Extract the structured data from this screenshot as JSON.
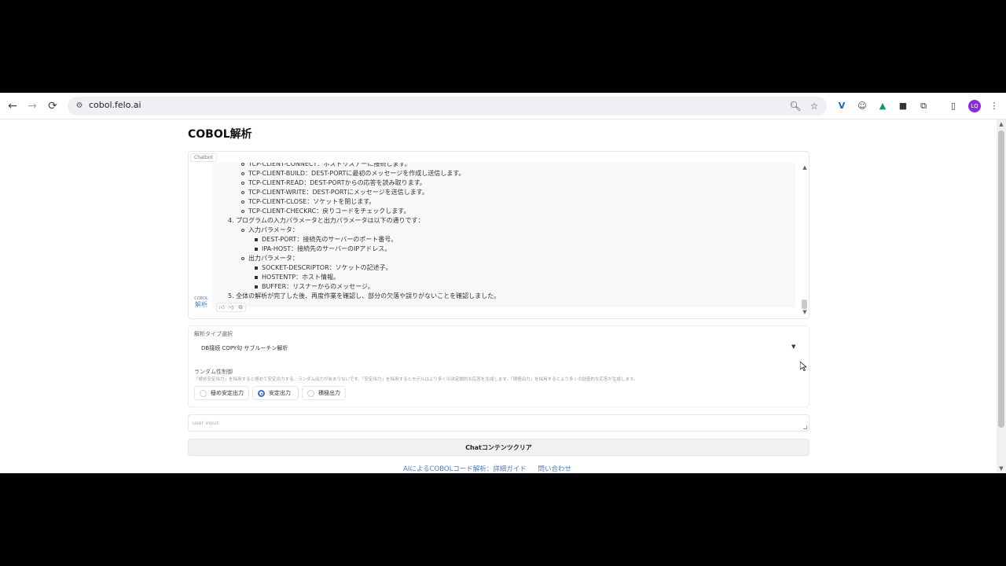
{
  "browser": {
    "url": "cobol.felo.ai",
    "nav": {
      "back": "←",
      "forward": "→",
      "reload": "⟳"
    },
    "profile_initials": "LQ"
  },
  "page": {
    "title": "COBOL解析",
    "chatbot_label": "Chatbot",
    "bot_avatar": {
      "small": "COBOL",
      "big": "解析"
    },
    "chat_lines": [
      {
        "level": 1,
        "text": "TCP-CLIENT-CONNECT：ホストリスナーに接続します。"
      },
      {
        "level": 1,
        "text": "TCP-CLIENT-BUILD：DEST-PORTに最初のメッセージを作成し送信します。"
      },
      {
        "level": 1,
        "text": "TCP-CLIENT-READ：DEST-PORTからの応答を読み取ります。"
      },
      {
        "level": 1,
        "text": "TCP-CLIENT-WRITE：DEST-PORTにメッセージを送信します。"
      },
      {
        "level": 1,
        "text": "TCP-CLIENT-CLOSE：ソケットを閉じます。"
      },
      {
        "level": 1,
        "text": "TCP-CLIENT-CHECKRC：戻りコードをチェックします。"
      },
      {
        "level": 0,
        "text": "4. プログラムの入力パラメータと出力パラメータは以下の通りです："
      },
      {
        "level": 1,
        "text": "入力パラメータ："
      },
      {
        "level": 2,
        "text": "DEST-PORT：接続先のサーバーのポート番号。"
      },
      {
        "level": 2,
        "text": "IPA-HOST：接続先のサーバーのIPアドレス。"
      },
      {
        "level": 1,
        "text": "出力パラメータ："
      },
      {
        "level": 2,
        "text": "SOCKET-DESCRIPTOR：ソケットの記述子。"
      },
      {
        "level": 2,
        "text": "HOSTENTP：ホスト情報。"
      },
      {
        "level": 2,
        "text": "BUFFER：リスナーからのメッセージ。"
      },
      {
        "level": 0,
        "text": "5. 全体の解析が完了した後、再度作業を確認し、部分の欠落や誤りがないことを確認しました。"
      }
    ],
    "analysis_type": {
      "label": "解析タイプ選択",
      "value": "DB接続 COPY句 サブルーチン解析"
    },
    "randomness": {
      "label": "ランダム性制御",
      "description": "「極め安定出力」を採用すると極めて安定出力する、ランダム出力があまりないです。「安定出力」を採用するとモデルはより多くの決定論的な応答を生成します。「積極出力」を採用するとより多くの創造的な応答が生成します。",
      "options": [
        {
          "label": "極め安定出力",
          "selected": false
        },
        {
          "label": "安定出力",
          "selected": true
        },
        {
          "label": "積極出力",
          "selected": false
        }
      ]
    },
    "input_placeholder": "user input",
    "clear_button": "Chatコンテンツクリア",
    "footer": {
      "link1": "AIによるCOBOLコード解析：詳細ガイド",
      "link2": "問い合わせ"
    }
  },
  "colors": {
    "accent": "#3b6fd8",
    "link": "#4a7cc4",
    "avatar": "#8a2be2"
  }
}
